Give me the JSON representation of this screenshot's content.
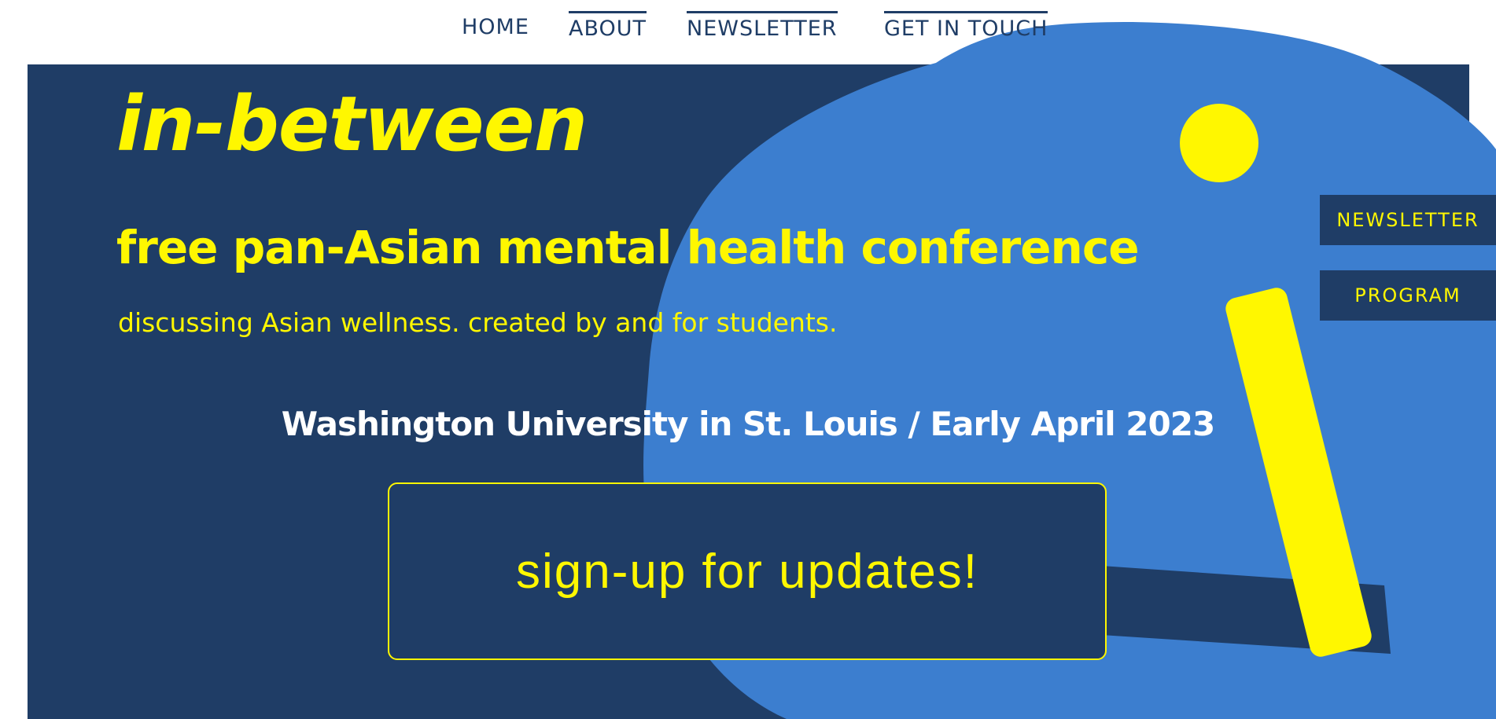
{
  "nav": {
    "items": [
      {
        "label": "HOME"
      },
      {
        "label": "ABOUT"
      },
      {
        "label": "NEWSLETTER"
      },
      {
        "label": "GET IN TOUCH"
      }
    ]
  },
  "hero": {
    "logo": "in-between",
    "headline": "free pan-Asian mental health conference",
    "subtitle": "discussing Asian wellness. created by and for students.",
    "event_info": "Washington University in St. Louis / Early April 2023",
    "cta_label": "sign-up for updates!"
  },
  "side_buttons": {
    "newsletter": "NEWSLETTER",
    "program": "PROGRAM"
  },
  "colors": {
    "navy": "#1f3d66",
    "bright_blue": "#3c7ecf",
    "yellow": "#fff700",
    "white": "#ffffff"
  }
}
